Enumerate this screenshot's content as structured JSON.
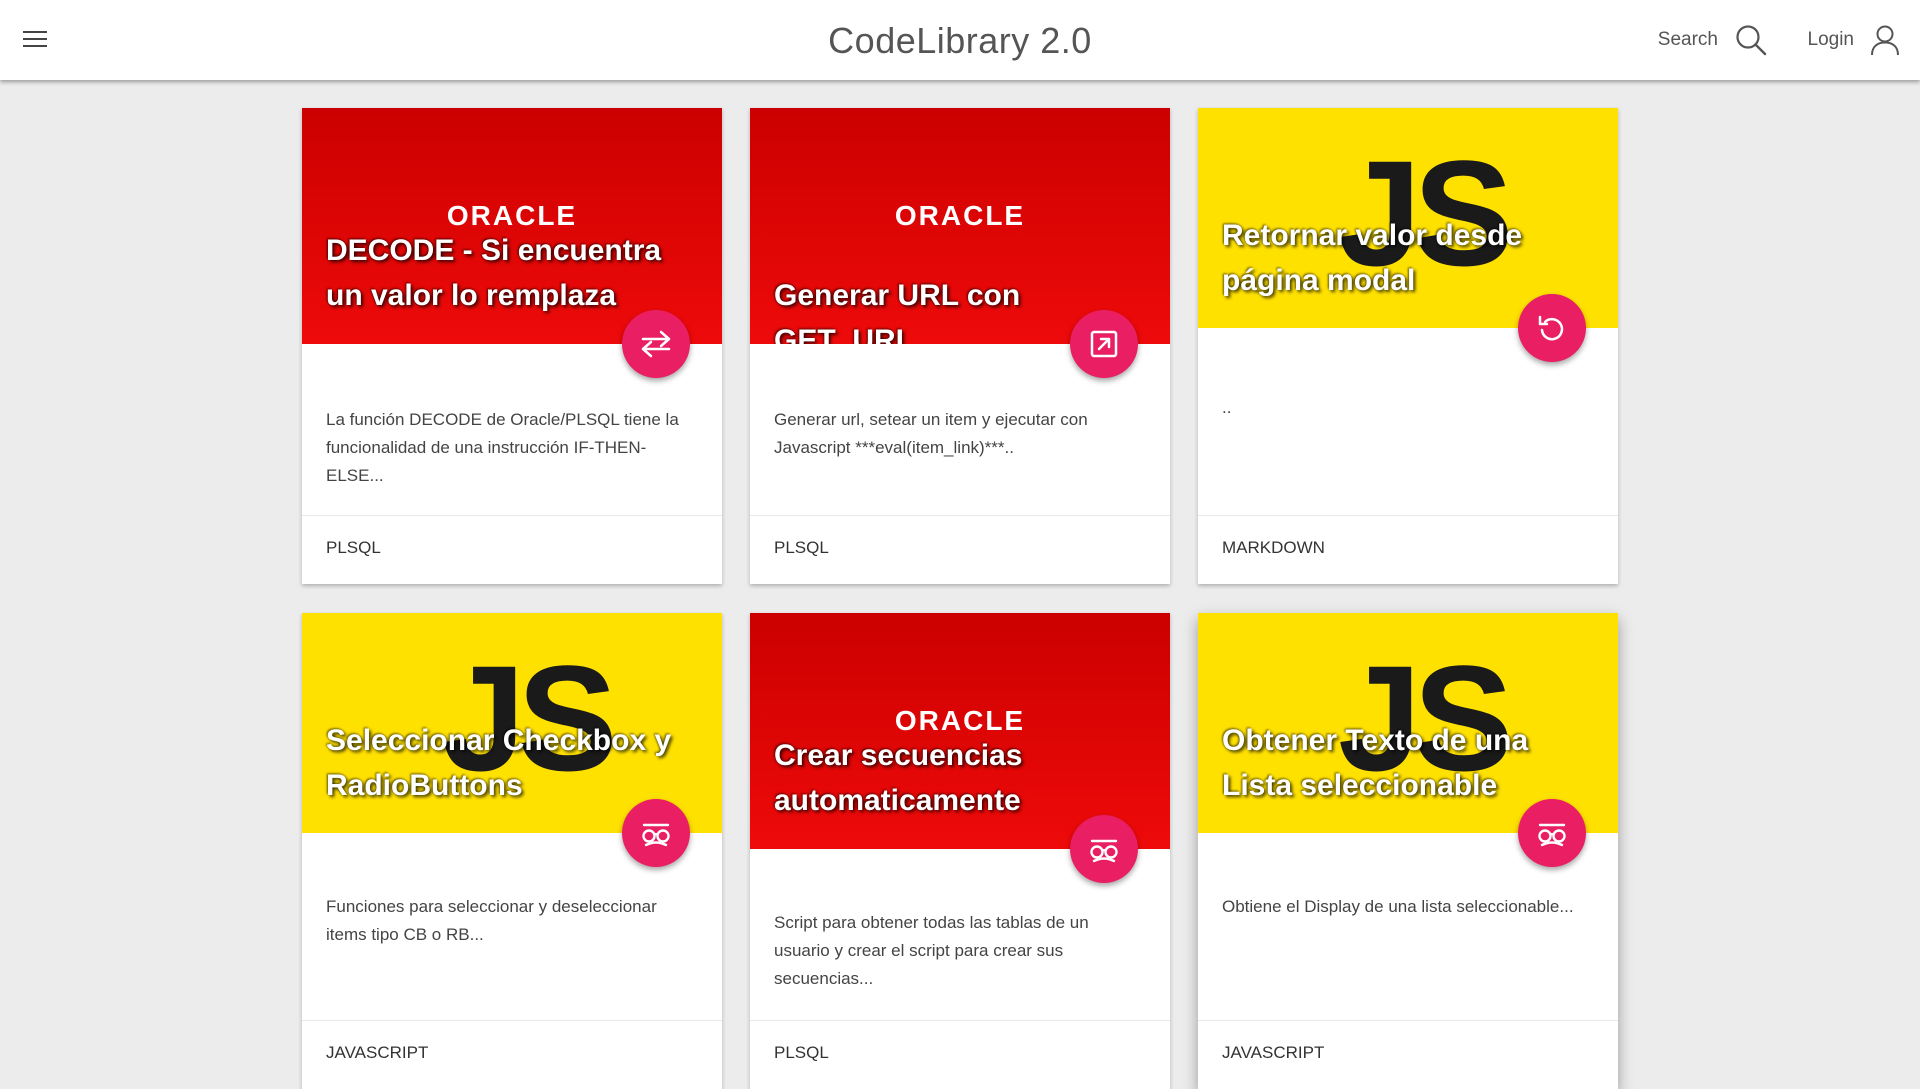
{
  "app": {
    "title": "CodeLibrary 2.0",
    "search_label": "Search",
    "login_label": "Login",
    "accent_color": "#e91e63"
  },
  "logos": {
    "oracle": "ORACLE",
    "js": "JS"
  },
  "cards": [
    {
      "title": "DECODE - Si encuentra un valor lo remplaza",
      "description": "La función DECODE de Oracle/PLSQL tiene la funcionalidad de una instrucción IF-THEN-ELSE...",
      "tag": "PLSQL",
      "banner": "oracle",
      "icon": "swap-icon"
    },
    {
      "title": "Generar URL con GET_URL",
      "description": "Generar url, setear un item y ejecutar con Javascript ***eval(item_link)***..",
      "tag": "PLSQL",
      "banner": "oracle",
      "icon": "open-link-icon"
    },
    {
      "title": "Retornar valor desde página modal",
      "description": "..",
      "tag": "MARKDOWN",
      "banner": "js",
      "icon": "undo-icon"
    },
    {
      "title": "Seleccionar Checkbox y RadioButtons",
      "description": "Funciones para seleccionar y deseleccionar items tipo CB o RB...",
      "tag": "JAVASCRIPT",
      "banner": "js",
      "icon": "incognito-icon"
    },
    {
      "title": "Crear secuencias automaticamente",
      "description": "Script para obtener todas las tablas de un usuario y crear el script para crear sus secuencias...",
      "tag": "PLSQL",
      "banner": "oracle",
      "icon": "incognito-icon"
    },
    {
      "title": "Obtener Texto de una Lista seleccionable",
      "description": "Obtiene el Display de una lista seleccionable...",
      "tag": "JAVASCRIPT",
      "banner": "js",
      "icon": "incognito-icon"
    }
  ]
}
